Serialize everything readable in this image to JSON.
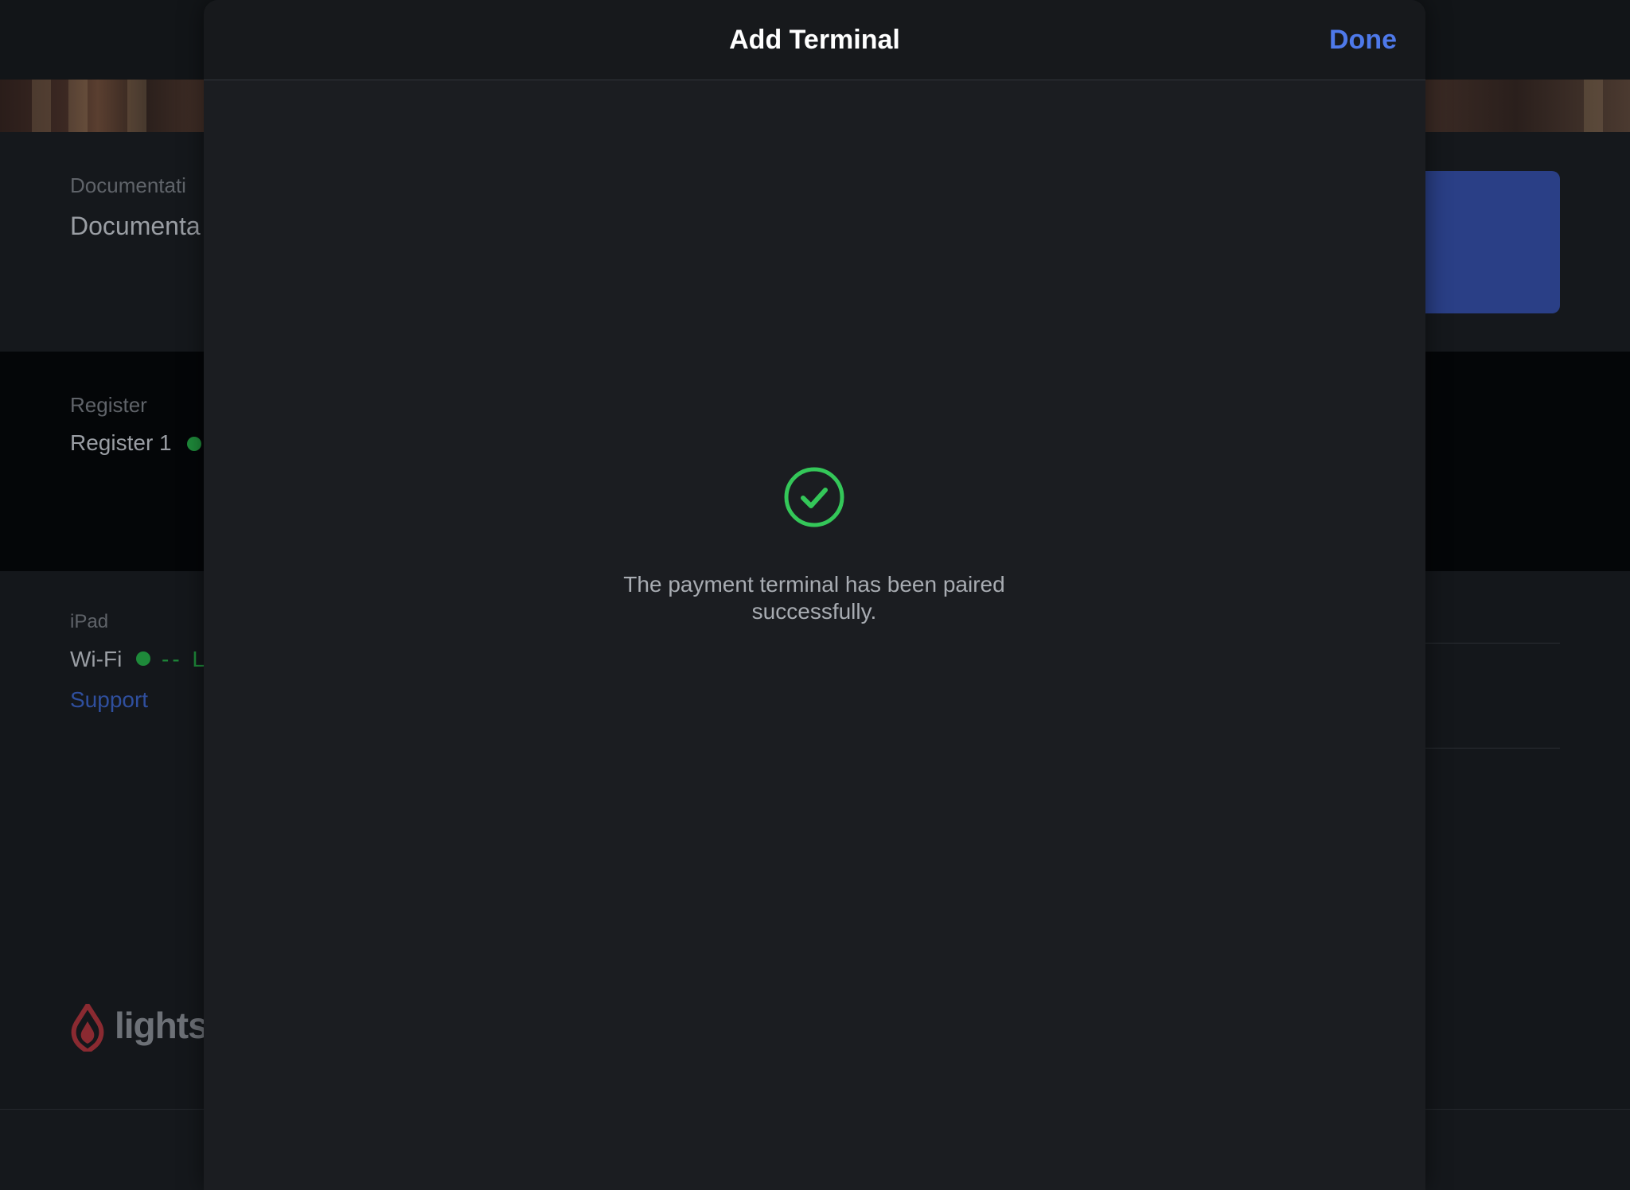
{
  "background": {
    "documentation": {
      "label": "Documentati",
      "value": "Documenta"
    },
    "register": {
      "label": "Register",
      "value": "Register 1"
    },
    "ipad": {
      "label": "iPad",
      "wifi_label": "Wi-Fi",
      "wifi_status": "-- L",
      "support_link": "Support"
    },
    "logo_text": "lightsp"
  },
  "modal": {
    "title": "Add Terminal",
    "done_label": "Done",
    "success_icon": "check-circle-icon",
    "success_message": "The payment terminal has been paired successfully."
  },
  "colors": {
    "accent": "#4e79ea",
    "success": "#34c759",
    "status_dot": "#1e8a3a"
  }
}
